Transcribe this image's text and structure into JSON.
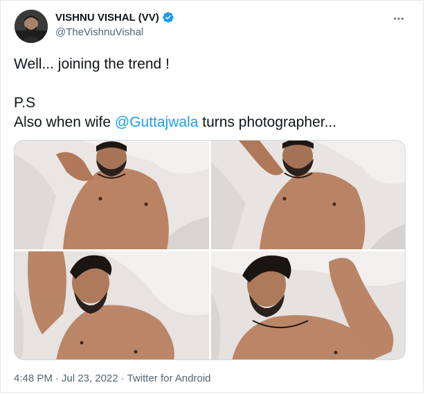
{
  "author": {
    "display_name": "VISHNU VISHAL (VV)",
    "handle": "@TheVishnuVishal",
    "verified_icon": "verified-badge-icon"
  },
  "tweet": {
    "line1": "Well... joining the trend !",
    "line2": "P.S",
    "line3_prefix": "Also when wife ",
    "line3_mention": "@Guttajwala",
    "line3_suffix": " turns photographer..."
  },
  "media": {
    "photo_count": 4
  },
  "meta": {
    "time": "4:48 PM",
    "date": "Jul 23, 2022",
    "source": "Twitter for Android",
    "separator": "·"
  },
  "colors": {
    "accent": "#1d9bf0",
    "text_primary": "#0f1419",
    "text_secondary": "#536471",
    "border": "#cfd9de"
  }
}
